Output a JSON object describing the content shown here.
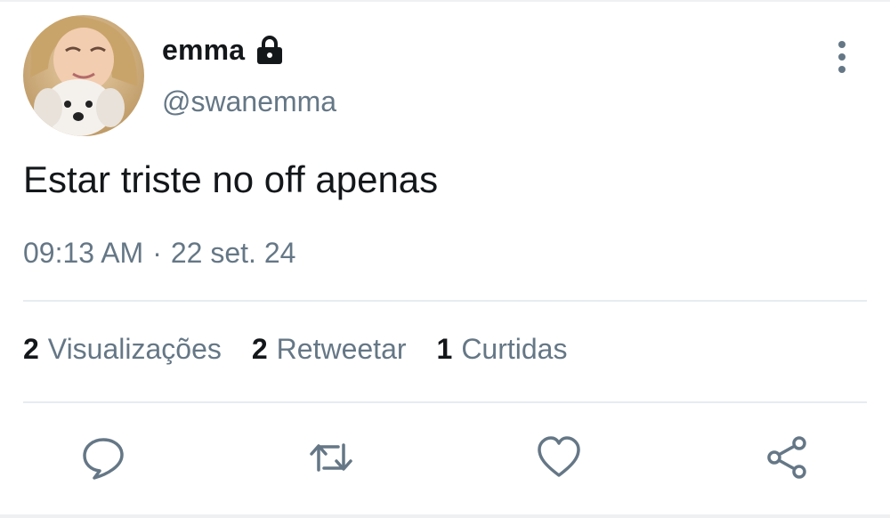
{
  "author": {
    "display_name": "emma",
    "handle": "@swanemma",
    "protected": true
  },
  "tweet": {
    "text": "Estar triste no off apenas",
    "time": "09:13 AM",
    "separator": "·",
    "date": "22 set. 24"
  },
  "stats": {
    "views_count": "2",
    "views_label": "Visualizações",
    "retweets_count": "2",
    "retweets_label": "Retweetar",
    "likes_count": "1",
    "likes_label": "Curtidas"
  },
  "icons": {
    "lock": "lock-icon",
    "more": "more-vertical-icon",
    "reply": "reply-icon",
    "retweet": "retweet-icon",
    "like": "heart-icon",
    "share": "share-icon"
  },
  "colors": {
    "text_primary": "#14171a",
    "text_secondary": "#657786",
    "icon": "#657786",
    "divider": "#e6ecf0"
  }
}
